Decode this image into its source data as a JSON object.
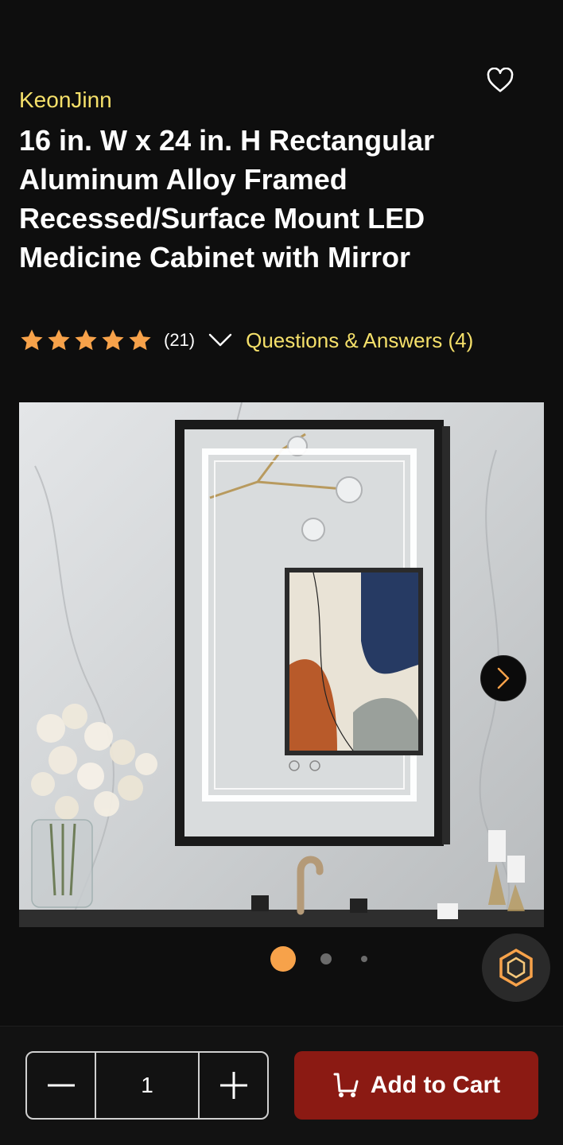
{
  "product": {
    "brand": "KeonJinn",
    "title": "16 in. W x 24 in. H Rectangular Aluminum Alloy Framed Recessed/Surface Mount LED Medicine Cabinet with Mirror",
    "rating": 5,
    "review_count": "(21)",
    "qa_link": "Questions & Answers (4)"
  },
  "icons": {
    "favorite": "heart-outline-icon",
    "star": "star-icon",
    "expand": "chevron-down-icon",
    "next": "chevron-right-icon",
    "assistant": "hexagon-assistant-icon",
    "minus": "minus-icon",
    "plus": "plus-icon",
    "cart": "cart-icon"
  },
  "gallery": {
    "image_alt": "LED medicine cabinet mirror in bathroom",
    "active_index": 0,
    "dot_count": 3
  },
  "purchase": {
    "quantity": "1",
    "add_to_cart": "Add to Cart"
  },
  "colors": {
    "brand": "#f5e06a",
    "star": "#f7a24a",
    "cart_button": "#8b1a13",
    "background": "#0e0e0e"
  }
}
